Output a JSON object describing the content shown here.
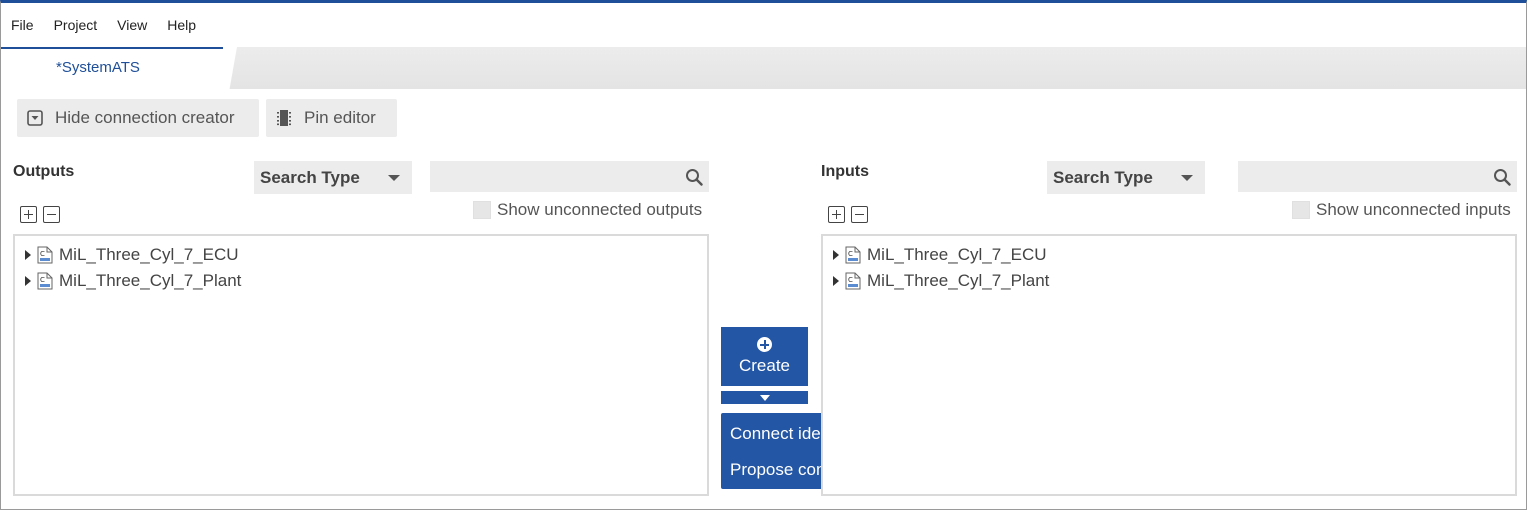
{
  "menubar": {
    "items": [
      "File",
      "Project",
      "View",
      "Help"
    ]
  },
  "tab": {
    "label": "*SystemATS"
  },
  "toolbar": {
    "hide_connection_creator": "Hide connection creator",
    "pin_editor": "Pin editor"
  },
  "outputs": {
    "title": "Outputs",
    "search_type": "Search Type",
    "search_value": "",
    "show_unconnected": "Show unconnected outputs",
    "tree": [
      "MiL_Three_Cyl_7_ECU",
      "MiL_Three_Cyl_7_Plant"
    ]
  },
  "inputs": {
    "title": "Inputs",
    "search_type": "Search Type",
    "search_value": "",
    "show_unconnected": "Show unconnected inputs",
    "tree": [
      "MiL_Three_Cyl_7_ECU",
      "MiL_Three_Cyl_7_Plant"
    ]
  },
  "create": {
    "label": "Create",
    "menu": [
      "Connect identical ports",
      "Propose connections"
    ]
  },
  "colors": {
    "accent": "#2356a4",
    "tab_border": "#1f4f99"
  }
}
